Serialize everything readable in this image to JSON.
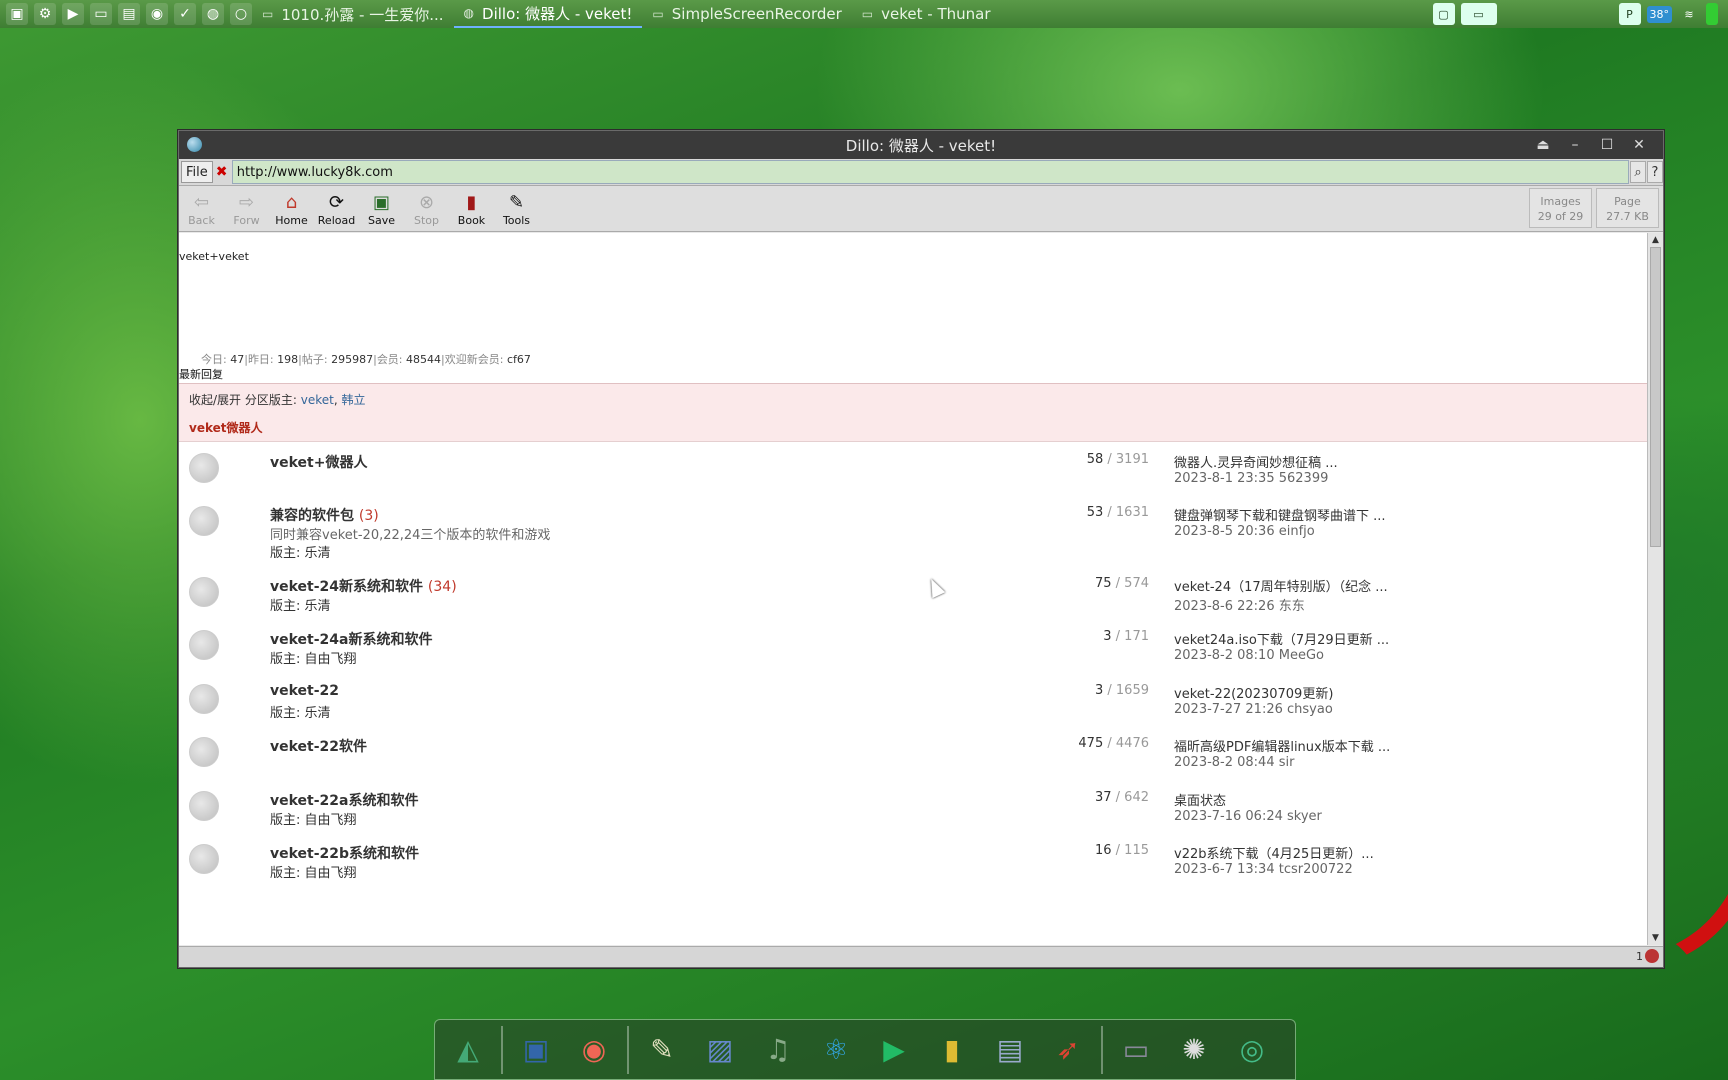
{
  "taskbar": {
    "tasks": [
      {
        "label": "1010.孙露 - 一生爱你...",
        "active": false
      },
      {
        "label": "Dillo: 微器人 - veket!",
        "active": true
      },
      {
        "label": "SimpleScreenRecorder",
        "active": false
      },
      {
        "label": "veket - Thunar",
        "active": false
      }
    ],
    "tray": {
      "temp": "38°",
      "p_label": "P"
    }
  },
  "window": {
    "title": "Dillo: 微器人 - veket!",
    "file_label": "File",
    "url": "http://www.lucky8k.com",
    "toolbar": {
      "back": "Back",
      "forw": "Forw",
      "home": "Home",
      "reload": "Reload",
      "save": "Save",
      "stop": "Stop",
      "book": "Book",
      "tools": "Tools"
    },
    "meters": {
      "images_label": "Images",
      "images_value": "29 of 29",
      "page_label": "Page",
      "page_value": "27.7 KB"
    },
    "status_right": "1"
  },
  "page": {
    "logo_alt": "veket+veket",
    "stats": {
      "today_label": "今日:",
      "today": "47",
      "yesterday_label": "昨日:",
      "yesterday": "198",
      "posts_label": "帖子:",
      "posts": "295987",
      "members_label": "会员:",
      "members": "48544",
      "welcome_label": "欢迎新会员:",
      "newest": "cf67"
    },
    "latest_label": "最新回复",
    "section": {
      "collapse_text": "收起/展开 分区版主:",
      "mods": [
        "veket",
        "韩立"
      ],
      "mods_sep": ",",
      "title": "veket微器人"
    },
    "forums": [
      {
        "name": "veket+微器人",
        "count": "",
        "desc": "",
        "mod": "",
        "today": "58",
        "total": "3191",
        "last": "微器人.灵异奇闻妙想征稿 ...",
        "last_meta": "2023-8-1 23:35 562399"
      },
      {
        "name": "兼容的软件包",
        "count": "(3)",
        "desc": "同时兼容veket-20,22,24三个版本的软件和游戏",
        "mod": "版主: 乐清",
        "today": "53",
        "total": "1631",
        "last": "键盘弹钢琴下载和键盘钢琴曲谱下 ...",
        "last_meta": "2023-8-5 20:36 einfjo"
      },
      {
        "name": "veket-24新系统和软件",
        "count": "(34)",
        "desc": "",
        "mod": "版主: 乐清",
        "today": "75",
        "total": "574",
        "last": "veket-24（17周年特别版）（纪念 ...",
        "last_meta": "2023-8-6 22:26 东东"
      },
      {
        "name": "veket-24a新系统和软件",
        "count": "",
        "desc": "",
        "mod": "版主: 自由飞翔",
        "today": "3",
        "total": "171",
        "last": "veket24a.iso下载（7月29日更新 ...",
        "last_meta": "2023-8-2 08:10 MeeGo"
      },
      {
        "name": "veket-22",
        "count": "",
        "desc": "",
        "mod": "版主: 乐清",
        "today": "3",
        "total": "1659",
        "last": "veket-22(20230709更新)",
        "last_meta": "2023-7-27 21:26 chsyao"
      },
      {
        "name": "veket-22软件",
        "count": "",
        "desc": "",
        "mod": "",
        "today": "475",
        "total": "4476",
        "last": "福昕高级PDF编辑器linux版本下载 ...",
        "last_meta": "2023-8-2 08:44 sir"
      },
      {
        "name": "veket-22a系统和软件",
        "count": "",
        "desc": "",
        "mod": "版主: 自由飞翔",
        "today": "37",
        "total": "642",
        "last": "桌面状态",
        "last_meta": "2023-7-16 06:24 skyer"
      },
      {
        "name": "veket-22b系统和软件",
        "count": "",
        "desc": "",
        "mod": "版主: 自由飞翔",
        "today": "16",
        "total": "115",
        "last": "v22b系统下载（4月25日更新）...",
        "last_meta": "2023-6-7 13:34 tcsr200722"
      }
    ],
    "num_sep": "/"
  },
  "dock": {
    "items": [
      "desktop-icon",
      "monitor-icon",
      "firefox-icon",
      "notepad-icon",
      "image-viewer-icon",
      "music-icon",
      "atom-icon",
      "media-player-icon",
      "notes-icon",
      "chart-icon",
      "rocket-icon",
      "drive-icon",
      "settings-icon",
      "network-icon"
    ]
  }
}
